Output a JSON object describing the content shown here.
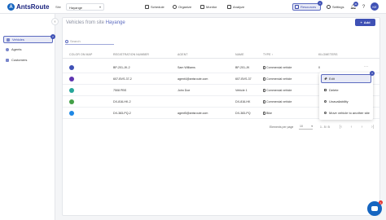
{
  "brand": {
    "name": "AntsRoute",
    "logo_letter": "A"
  },
  "site_select": {
    "label": "Site",
    "value": "Hayange"
  },
  "nav": [
    {
      "label": "Schedule"
    },
    {
      "label": "Organize"
    },
    {
      "label": "Monitor"
    },
    {
      "label": "Analyze"
    },
    {
      "label": "Resources",
      "badge": "1",
      "active": true
    },
    {
      "label": "Settings"
    }
  ],
  "header_icons": {
    "notification_badge": "41",
    "help": "?",
    "avatar_initials": "KE"
  },
  "sidebar": {
    "items": [
      {
        "label": "Vehicles",
        "badge": "2",
        "active": true
      },
      {
        "label": "Agents"
      },
      {
        "label": "Customers"
      }
    ]
  },
  "page": {
    "title_prefix": "Vehicles from site",
    "title_site": "Hayange",
    "add_label": "Add",
    "search_placeholder": "Search"
  },
  "table": {
    "columns": [
      "Color on map",
      "Registration number",
      "Agent",
      "Name",
      "Type",
      "Kilometers"
    ],
    "type_sort_arrow": "↑",
    "rows": [
      {
        "color": "#3f51b5",
        "reg": "BP-201-JK-2",
        "agent": "Sam Williams",
        "name": "BP-201-JK",
        "type": "Commercial vehicle",
        "km": "0"
      },
      {
        "color": "#5e35b1",
        "reg": "607-BVS-37-2",
        "agent": "agent4@antsroute.com",
        "name": "607-BVS-37",
        "type": "Commercial vehicle",
        "km": ""
      },
      {
        "color": "#26a69a",
        "reg": "7508 PBS",
        "agent": "John Doe",
        "name": "Vehicle 1",
        "type": "Commercial vehicle",
        "km": ""
      },
      {
        "color": "#43a047",
        "reg": "DX-816-HK-2",
        "agent": "",
        "name": "DX-816-HK",
        "type": "Commercial vehicle",
        "km": ""
      },
      {
        "color": "#1e88e5",
        "reg": "DX-383-PQ-2",
        "agent": "agent5@antsroute.com",
        "name": "DX-383-PQ",
        "type": "Bike",
        "km": ""
      }
    ]
  },
  "pagination": {
    "per_page_label": "Elements per page",
    "per_page_value": "10",
    "range": "1 - 5 / 5"
  },
  "menu": {
    "badge": "3",
    "items": [
      {
        "label": "Edit",
        "active": true
      },
      {
        "label": "Delete"
      },
      {
        "label": "Unavailability"
      },
      {
        "label": "Move vehicle to another site"
      }
    ]
  },
  "chat": {
    "badge": "1"
  }
}
